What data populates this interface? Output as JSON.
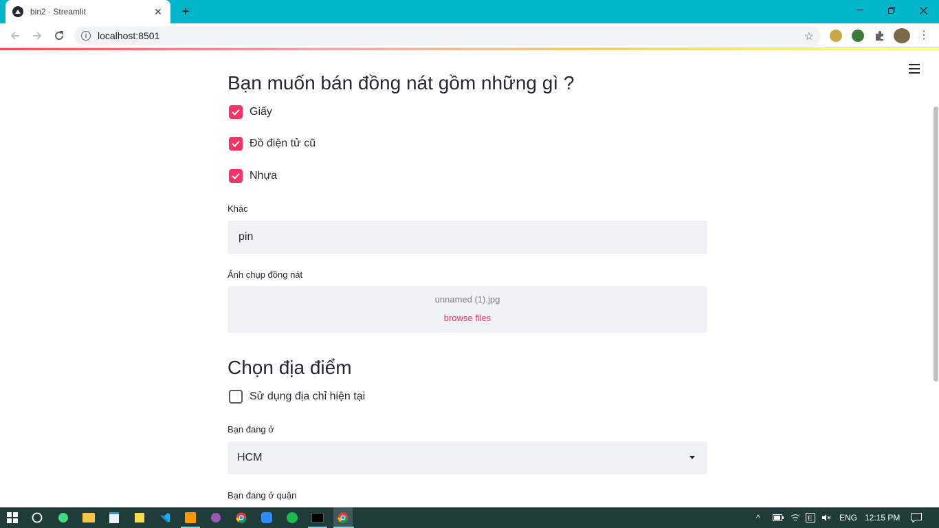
{
  "browser": {
    "tab_title": "bin2 · Streamlit",
    "url": "localhost:8501"
  },
  "form": {
    "heading_items": "Bạn muốn bán đồng nát gồm những gì ?",
    "checkboxes": [
      {
        "label": "Giấy",
        "checked": true
      },
      {
        "label": "Đồ điện tử cũ",
        "checked": true
      },
      {
        "label": "Nhựa",
        "checked": true
      }
    ],
    "other_label": "Khác",
    "other_value": "pin",
    "photo_label": "Ảnh chụp đồng nát",
    "photo_filename": "unnamed (1).jpg",
    "browse_files": "browse files",
    "heading_location": "Chọn địa điểm",
    "use_current_address": {
      "label": "Sử dụng địa chỉ hiện tại",
      "checked": false
    },
    "city_label": "Bạn đang ở",
    "city_value": "HCM",
    "district_label": "Bạn đang ở quận"
  },
  "taskbar": {
    "lang": "ENG",
    "time": "12:15 PM"
  },
  "colors": {
    "accent": "#f63366",
    "chrome_frame": "#00b4c9",
    "taskbar": "#1f3b3a"
  }
}
